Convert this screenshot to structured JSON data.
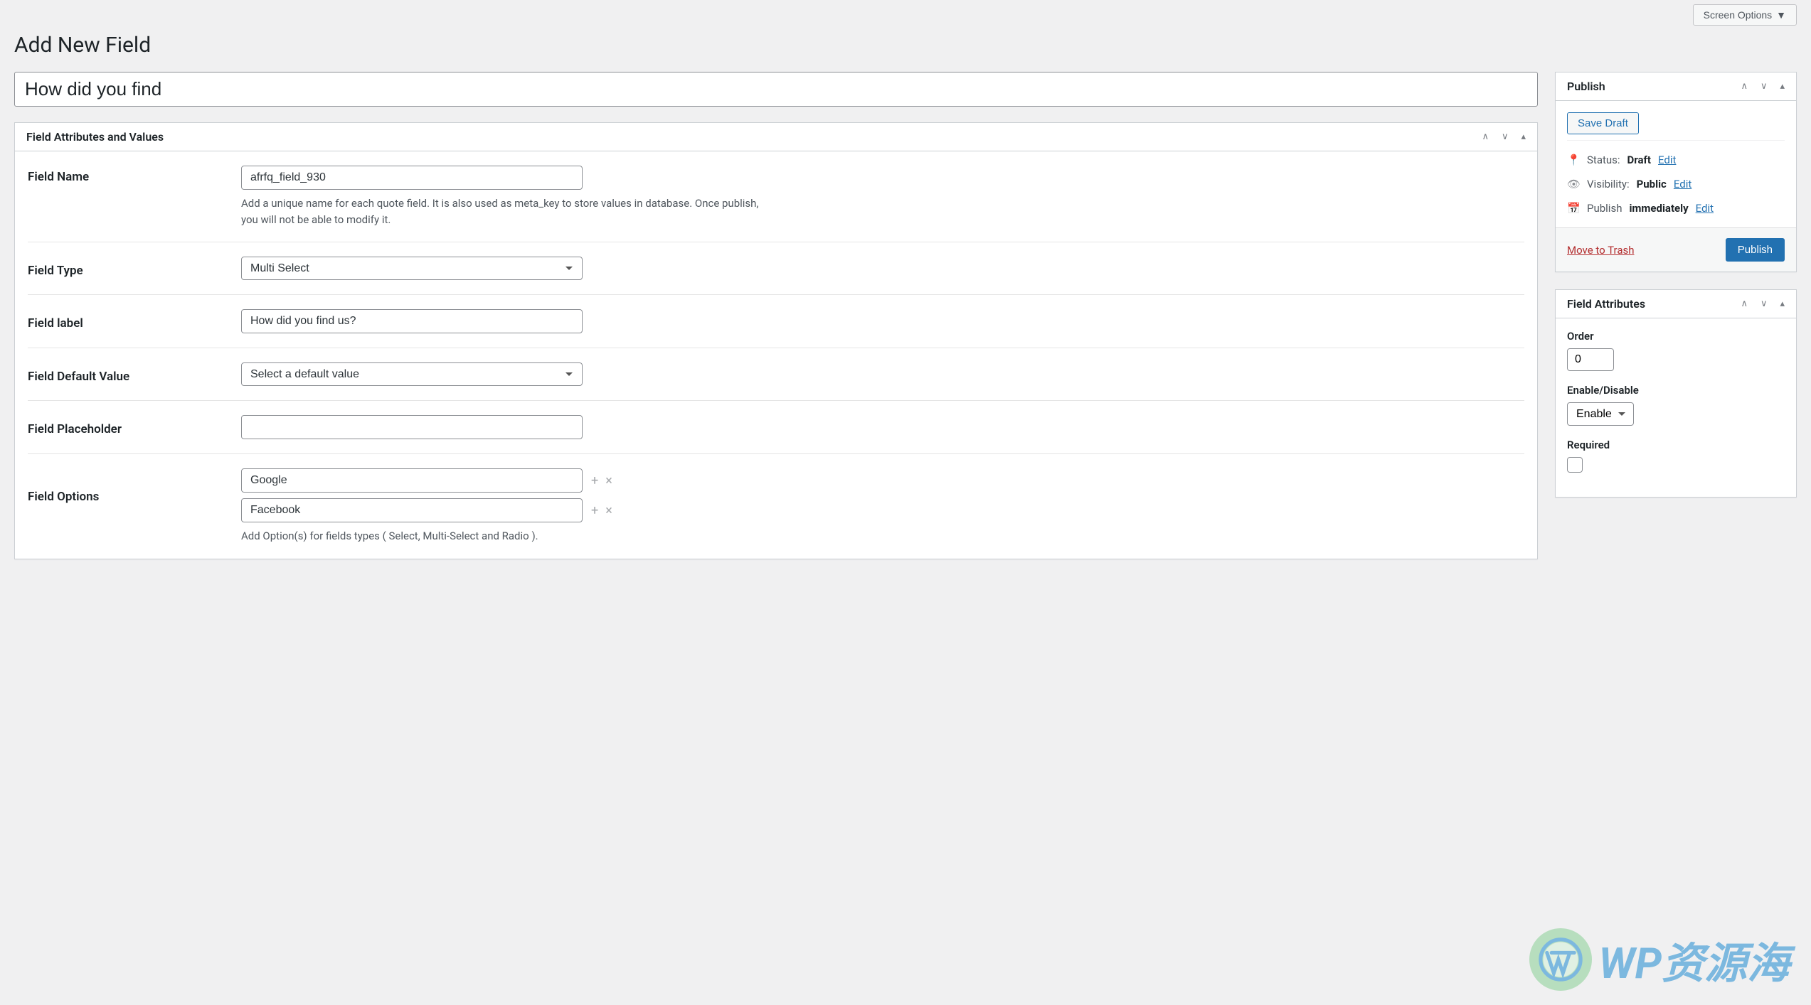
{
  "header": {
    "screen_options": "Screen Options",
    "page_title": "Add New Field"
  },
  "title_input": {
    "value": "How did you find"
  },
  "attributes_panel": {
    "heading": "Field Attributes and Values",
    "rows": {
      "field_name": {
        "label": "Field Name",
        "value": "afrfq_field_930",
        "description": "Add a unique name for each quote field. It is also used as meta_key to store values in database. Once publish, you will not be able to modify it."
      },
      "field_type": {
        "label": "Field Type",
        "value": "Multi Select"
      },
      "field_label": {
        "label": "Field label",
        "value": "How did you find us?"
      },
      "field_default_value": {
        "label": "Field Default Value",
        "value": "Select a default value"
      },
      "field_placeholder": {
        "label": "Field Placeholder",
        "value": ""
      },
      "field_options": {
        "label": "Field Options",
        "options": [
          "Google",
          "Facebook"
        ],
        "description": "Add Option(s) for fields types ( Select, Multi-Select and Radio )."
      }
    }
  },
  "publish_panel": {
    "heading": "Publish",
    "save_draft": "Save Draft",
    "status_label": "Status:",
    "status_value": "Draft",
    "visibility_label": "Visibility:",
    "visibility_value": "Public",
    "publish_label": "Publish",
    "publish_value": "immediately",
    "edit_link": "Edit",
    "trash": "Move to Trash",
    "publish_button": "Publish"
  },
  "field_attributes_panel": {
    "heading": "Field Attributes",
    "order_label": "Order",
    "order_value": "0",
    "enable_disable_label": "Enable/Disable",
    "enable_disable_value": "Enable",
    "required_label": "Required"
  },
  "watermark": "WP资源海"
}
